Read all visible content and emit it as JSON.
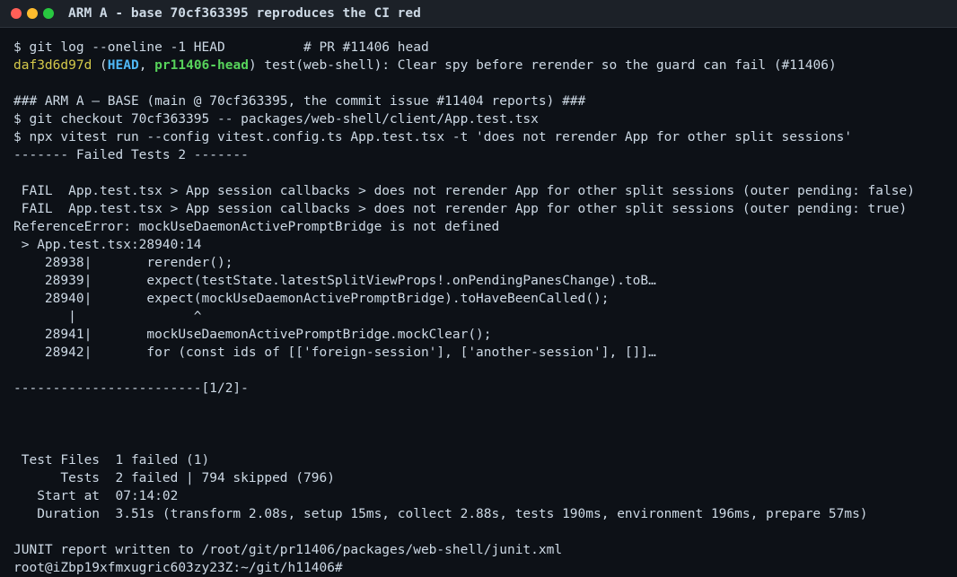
{
  "window": {
    "title": "ARM A - base 70cf363395 reproduces the CI red"
  },
  "colors": {
    "background": "#0d1117",
    "text": "#cdd9e5",
    "hash": "#d4c94a",
    "head_ref": "#4fb7f5",
    "branch_ref": "#57d35b"
  },
  "terminal": {
    "lines": [
      "$ git log --oneline -1 HEAD          # PR #11406 head",
      "",
      "",
      "### ARM A — BASE (main @ 70cf363395, the commit issue #11404 reports) ###",
      "$ git checkout 70cf363395 -- packages/web-shell/client/App.test.tsx",
      "$ npx vitest run --config vitest.config.ts App.test.tsx -t 'does not rerender App for other split sessions'",
      "------- Failed Tests 2 -------",
      "",
      " FAIL  App.test.tsx > App session callbacks > does not rerender App for other split sessions (outer pending: false)",
      " FAIL  App.test.tsx > App session callbacks > does not rerender App for other split sessions (outer pending: true)",
      "ReferenceError: mockUseDaemonActivePromptBridge is not defined",
      " > App.test.tsx:28940:14",
      "    28938|       rerender();",
      "    28939|       expect(testState.latestSplitViewProps!.onPendingPanesChange).toB…",
      "    28940|       expect(mockUseDaemonActivePromptBridge).toHaveBeenCalled();",
      "       |               ^",
      "    28941|       mockUseDaemonActivePromptBridge.mockClear();",
      "    28942|       for (const ids of [['foreign-session'], ['another-session'], []]…",
      "",
      "------------------------[1/2]-",
      "",
      "",
      "",
      " Test Files  1 failed (1)",
      "      Tests  2 failed | 794 skipped (796)",
      "   Start at  07:14:02",
      "   Duration  3.51s (transform 2.08s, setup 15ms, collect 2.88s, tests 190ms, environment 196ms, prepare 57ms)",
      "",
      "JUNIT report written to /root/git/pr11406/packages/web-shell/junit.xml",
      "root@iZbp19xfmxugric603zy23Z:~/git/h11406#"
    ],
    "commit_line": {
      "hash": "daf3d6d97d",
      "open_paren": " (",
      "head_ref": "HEAD",
      "separator": ", ",
      "branch_ref": "pr11406-head",
      "close_paren": ")",
      "message": " test(web-shell): Clear spy before rerender so the guard can fail (#11406)"
    }
  }
}
